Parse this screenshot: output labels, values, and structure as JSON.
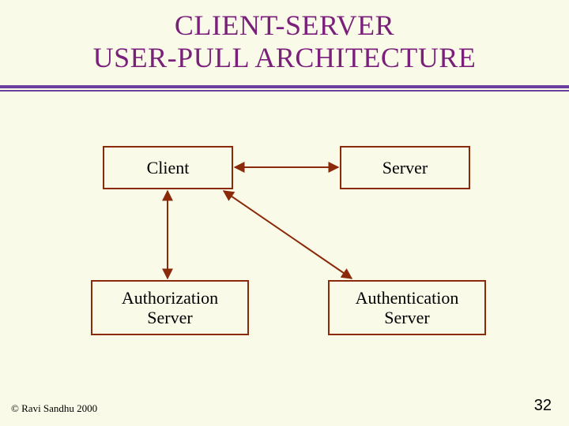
{
  "title": {
    "line1": "CLIENT-SERVER",
    "line2": "USER-PULL ARCHITECTURE"
  },
  "boxes": {
    "client": "Client",
    "server": "Server",
    "authz": "Authorization\nServer",
    "authn": "Authentication\nServer"
  },
  "footer": {
    "copyright": "© Ravi Sandhu 2000",
    "page": "32"
  },
  "colors": {
    "background": "#fafae8",
    "title": "#7a1f7a",
    "rule": "#6a3fa0",
    "boxBorder": "#8a2a0a",
    "arrow": "#8a2a0a"
  }
}
